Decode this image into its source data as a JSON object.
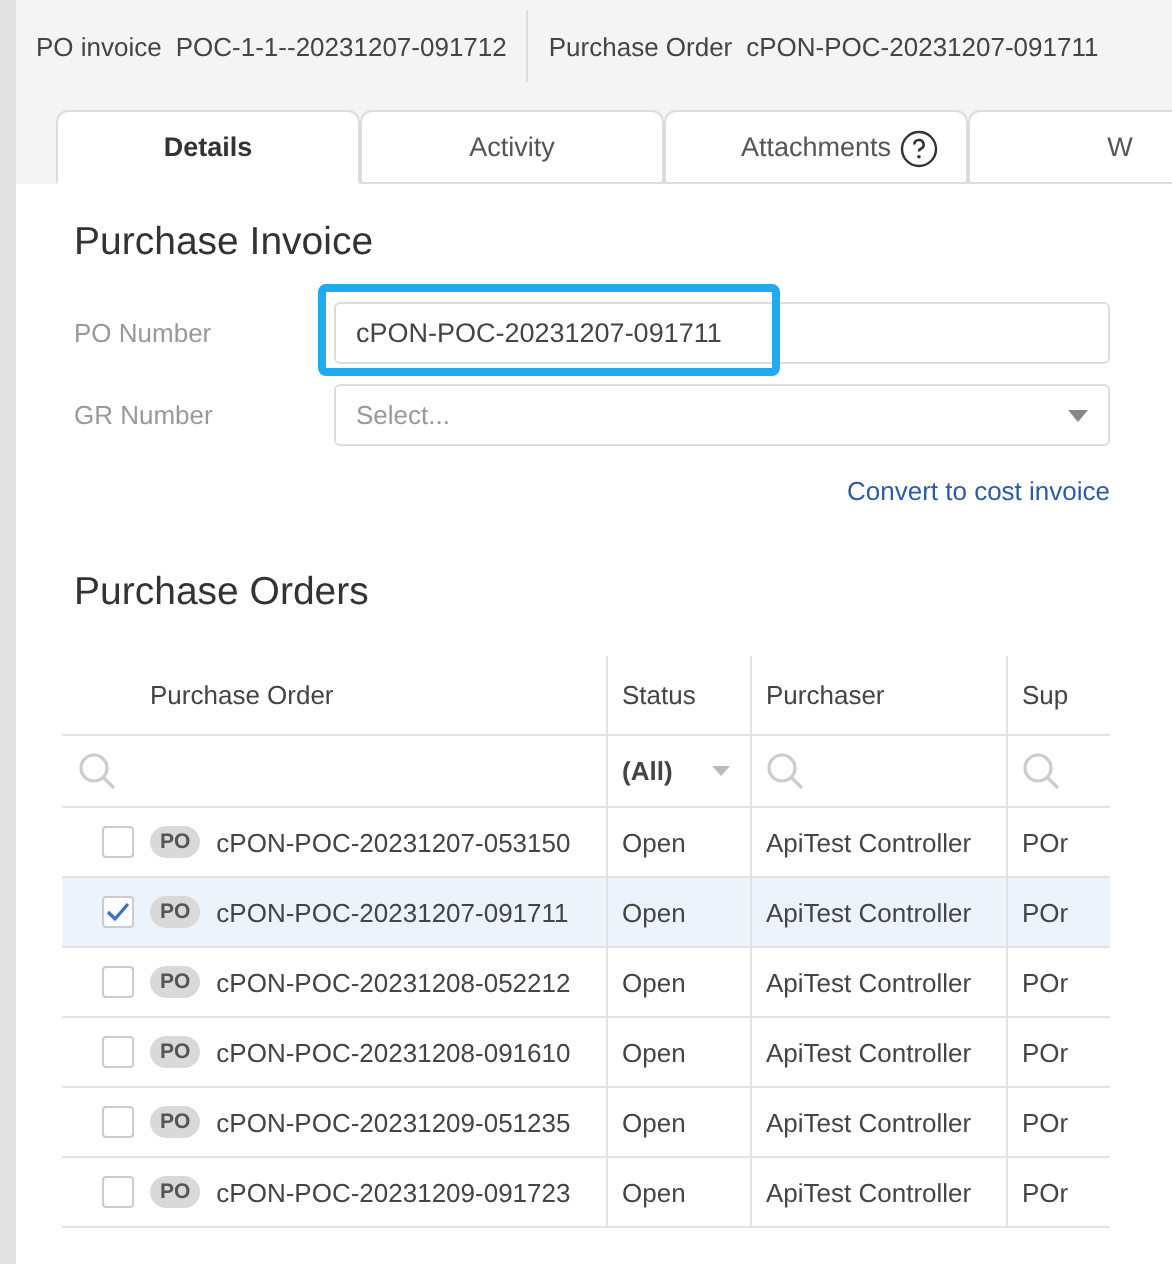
{
  "header": [
    {
      "label": "PO invoice",
      "value": "POC-1-1--20231207-091712"
    },
    {
      "label": "Purchase Order",
      "value": "cPON-POC-20231207-091711"
    }
  ],
  "tabs": [
    {
      "label": "Details",
      "selected": true,
      "help": false
    },
    {
      "label": "Activity",
      "selected": false,
      "help": false
    },
    {
      "label": "Attachments",
      "selected": false,
      "help": true
    },
    {
      "label": "W",
      "selected": false,
      "help": false
    }
  ],
  "invoice": {
    "title": "Purchase Invoice",
    "po_number": {
      "label": "PO Number",
      "value": "cPON-POC-20231207-091711",
      "highlighted": true
    },
    "gr_number": {
      "label": "GR Number",
      "placeholder": "Select..."
    },
    "link": "Convert to cost invoice"
  },
  "orders": {
    "title": "Purchase Orders",
    "columns": [
      "Purchase Order",
      "Status",
      "Purchaser",
      "Sup"
    ],
    "status_filter": "(All)",
    "rows": [
      {
        "badge": "PO",
        "number": "cPON-POC-20231207-053150",
        "status": "Open",
        "purchaser": "ApiTest Controller",
        "supplier": "POr",
        "selected": false
      },
      {
        "badge": "PO",
        "number": "cPON-POC-20231207-091711",
        "status": "Open",
        "purchaser": "ApiTest Controller",
        "supplier": "POr",
        "selected": true
      },
      {
        "badge": "PO",
        "number": "cPON-POC-20231208-052212",
        "status": "Open",
        "purchaser": "ApiTest Controller",
        "supplier": "POr",
        "selected": false
      },
      {
        "badge": "PO",
        "number": "cPON-POC-20231208-091610",
        "status": "Open",
        "purchaser": "ApiTest Controller",
        "supplier": "POr",
        "selected": false
      },
      {
        "badge": "PO",
        "number": "cPON-POC-20231209-051235",
        "status": "Open",
        "purchaser": "ApiTest Controller",
        "supplier": "POr",
        "selected": false
      },
      {
        "badge": "PO",
        "number": "cPON-POC-20231209-091723",
        "status": "Open",
        "purchaser": "ApiTest Controller",
        "supplier": "POr",
        "selected": false
      }
    ]
  }
}
